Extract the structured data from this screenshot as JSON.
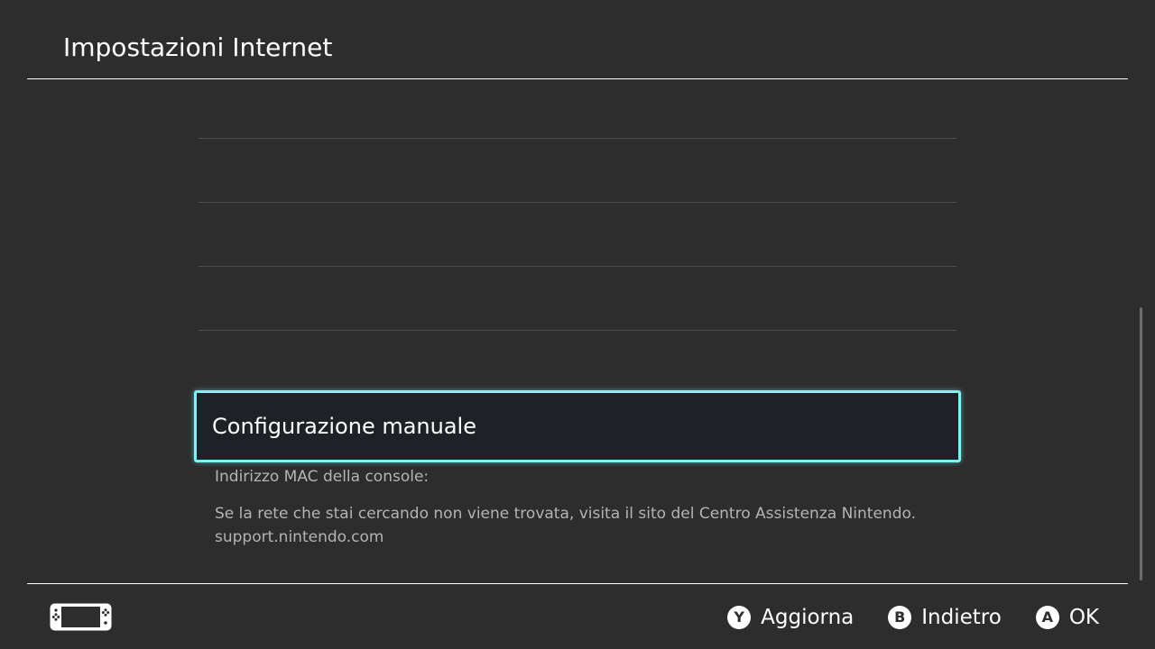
{
  "header": {
    "title": "Impostazioni Internet"
  },
  "network_list": {
    "empty_rows": 4,
    "selected_item_label": "Configurazione manuale"
  },
  "info": {
    "mac_address_label": "Indirizzo MAC della console:",
    "help_text": "Se la rete che stai cercando non viene trovata, visita il sito del Centro Assistenza Nintendo.",
    "help_url": "support.nintendo.com"
  },
  "footer": {
    "console_icon": "switch-console-icon",
    "hints": [
      {
        "button": "Y",
        "label": "Aggiorna"
      },
      {
        "button": "B",
        "label": "Indietro"
      },
      {
        "button": "A",
        "label": "OK"
      }
    ]
  },
  "colors": {
    "background": "#2d2d2d",
    "selection_border": "#7af4f4",
    "selection_fill": "#1e2126",
    "secondary_text": "#b4b4b4",
    "separator": "#4d4d4d"
  }
}
